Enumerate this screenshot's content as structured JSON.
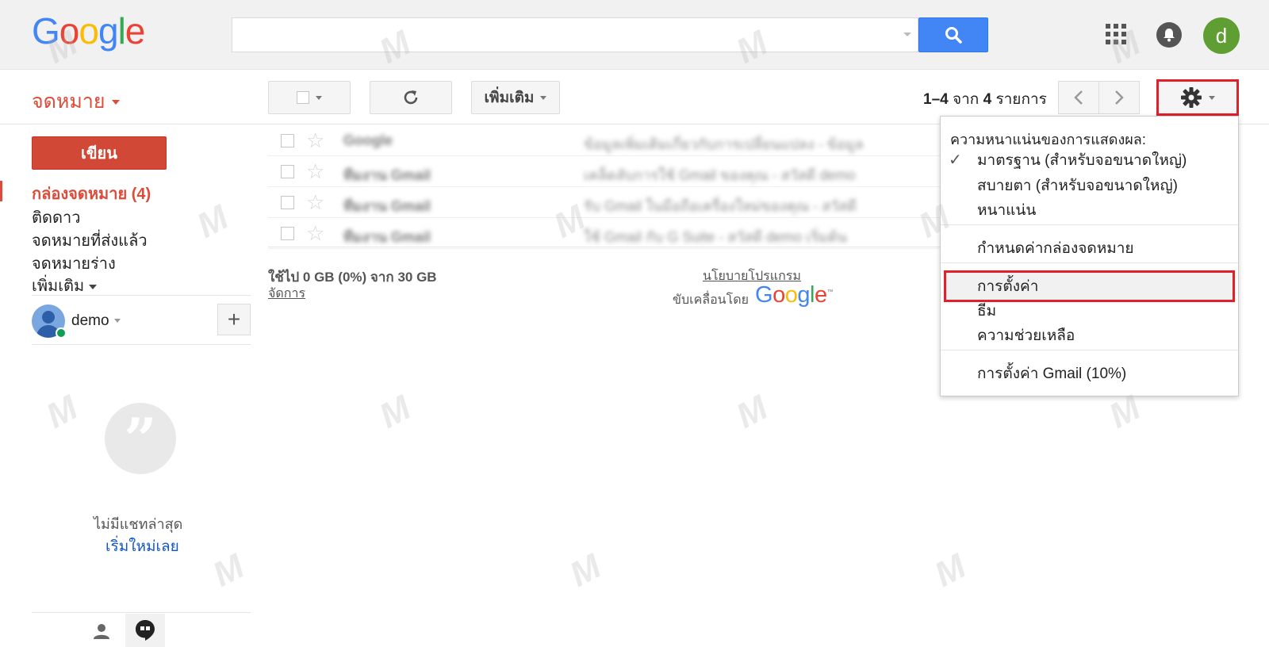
{
  "header": {
    "logo_letters": [
      {
        "ch": "G",
        "color": "#4285f4"
      },
      {
        "ch": "o",
        "color": "#ea4335"
      },
      {
        "ch": "o",
        "color": "#fbbc05"
      },
      {
        "ch": "g",
        "color": "#4285f4"
      },
      {
        "ch": "l",
        "color": "#34a853"
      },
      {
        "ch": "e",
        "color": "#ea4335"
      }
    ],
    "search_value": "",
    "avatar_letter": "d"
  },
  "toolbar": {
    "mail_label": "จดหมาย",
    "more_label": "เพิ่มเติม",
    "pager_range": "1–4",
    "pager_of": "จาก",
    "pager_total": "4",
    "pager_unit": "รายการ"
  },
  "sidebar": {
    "compose_label": "เขียน",
    "items": [
      {
        "label": "กล่องจดหมาย (4)",
        "active": true
      },
      {
        "label": "ติดดาว"
      },
      {
        "label": "จดหมายที่ส่งแล้ว"
      },
      {
        "label": "จดหมายร่าง"
      },
      {
        "label": "เพิ่มเติม"
      }
    ],
    "hangouts_user": "demo",
    "no_chat_text": "ไม่มีแชทล่าสุด",
    "start_new_text": "เริ่มใหม่เลย"
  },
  "mail_list": [
    {
      "sender": "Google",
      "subject": "ข้อมูลเพิ่มเติมเกี่ยวกับการเปลี่ยนแปลง - ข้อมูล"
    },
    {
      "sender": "ทีมงาน Gmail",
      "subject": "เคล็ดลับการใช้ Gmail ของคุณ - สวัสดี demo"
    },
    {
      "sender": "ทีมงาน Gmail",
      "subject": "รับ Gmail ในมือถือเครื่องใหม่ของคุณ - สวัสดี"
    },
    {
      "sender": "ทีมงาน Gmail",
      "subject": "ใช้ Gmail กับ G Suite - สวัสดี demo เริ่มต้น"
    }
  ],
  "footer": {
    "storage_text": "ใช้ไป 0 GB (0%) จาก 30 GB",
    "manage_text": "จัดการ",
    "policy_text": "นโยบายโปรแกรม",
    "powered_text": "ขับเคลื่อนโดย",
    "tm": "™"
  },
  "settings_menu": {
    "heading": "ความหนาแน่นของการแสดงผล:",
    "check_glyph": "✓",
    "density_options": [
      "มาตรฐาน (สำหรับจอขนาดใหญ่)",
      "สบายตา (สำหรับจอขนาดใหญ่)",
      "หนาแน่น"
    ],
    "configure_inbox": "กำหนดค่ากล่องจดหมาย",
    "settings": "การตั้งค่า",
    "themes": "ธีม",
    "help": "ความช่วยเหลือ",
    "gmail_settings": "การตั้งค่า Gmail (10%)"
  },
  "colors": {
    "accent_red": "#dd4b39",
    "search_blue": "#4285f4",
    "highlight_red": "#e0202a",
    "avatar_green": "#5f9e33"
  }
}
